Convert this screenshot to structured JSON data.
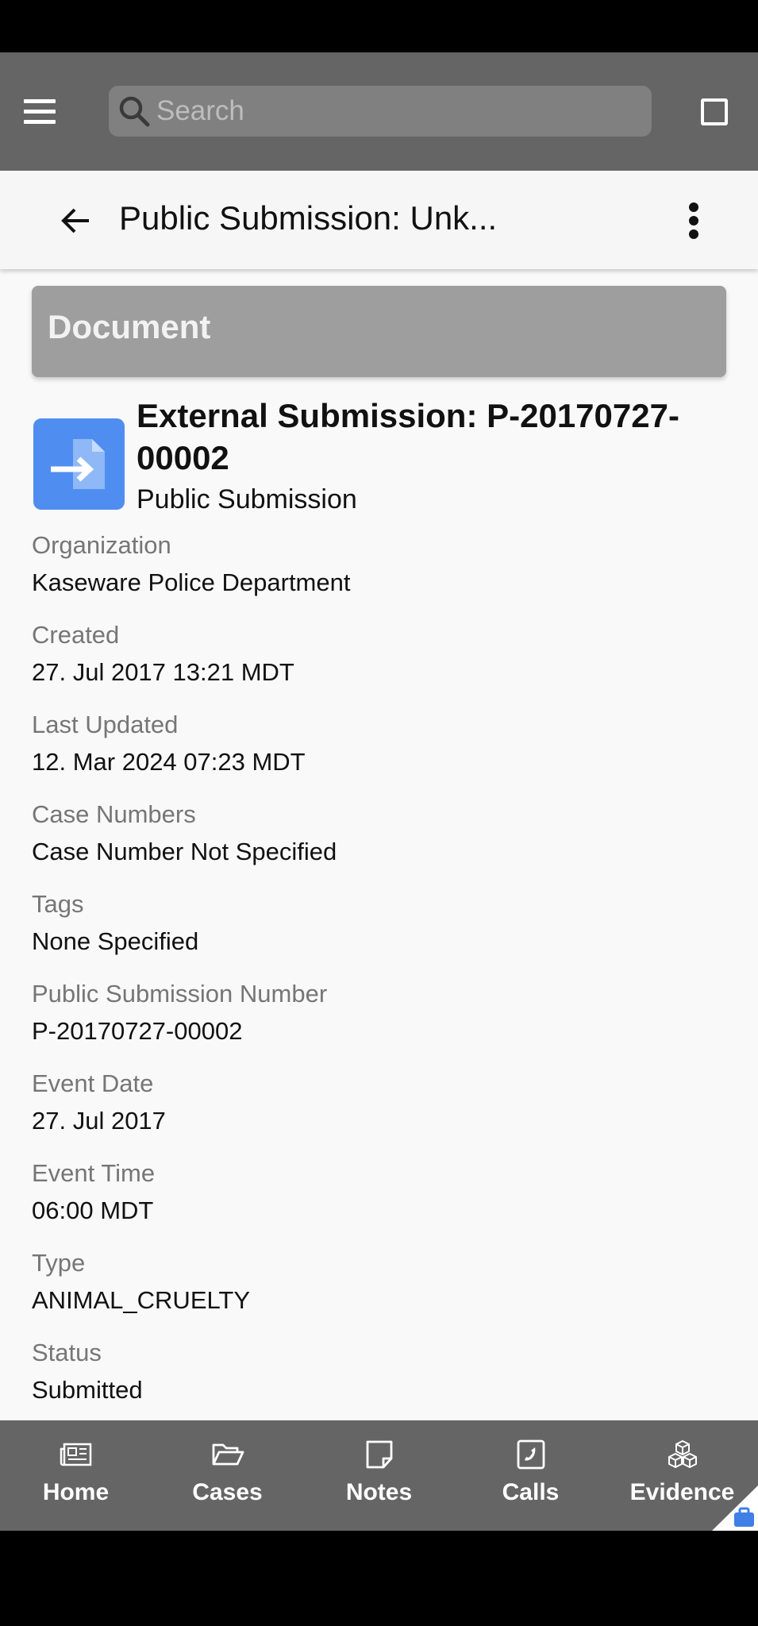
{
  "search": {
    "placeholder": "Search"
  },
  "title_bar": {
    "title": "Public Submission: Unk..."
  },
  "section": {
    "header": "Document"
  },
  "document": {
    "heading": "External Submission: P-20170727-00002",
    "subtype": "Public Submission",
    "icon": "document-arrow-icon",
    "icon_color": "#4f8ef0"
  },
  "fields": [
    {
      "label": "Organization",
      "value": "Kaseware Police Department"
    },
    {
      "label": "Created",
      "value": "27. Jul 2017 13:21 MDT"
    },
    {
      "label": "Last Updated",
      "value": "12. Mar 2024 07:23 MDT"
    },
    {
      "label": "Case Numbers",
      "value": "Case Number Not Specified"
    },
    {
      "label": "Tags",
      "value": "None Specified"
    },
    {
      "label": "Public Submission Number",
      "value": "P-20170727-00002"
    },
    {
      "label": "Event Date",
      "value": "27. Jul 2017"
    },
    {
      "label": "Event Time",
      "value": "06:00 MDT"
    },
    {
      "label": "Type",
      "value": "ANIMAL_CRUELTY"
    },
    {
      "label": "Status",
      "value": "Submitted"
    }
  ],
  "bottom_nav": [
    {
      "label": "Home",
      "icon": "newspaper-icon"
    },
    {
      "label": "Cases",
      "icon": "folder-open-icon"
    },
    {
      "label": "Notes",
      "icon": "note-icon"
    },
    {
      "label": "Calls",
      "icon": "phone-icon"
    },
    {
      "label": "Evidence",
      "icon": "cubes-icon"
    }
  ],
  "colors": {
    "app_bar": "#656565",
    "section_header": "#9e9e9e",
    "accent": "#4f8ef0"
  }
}
